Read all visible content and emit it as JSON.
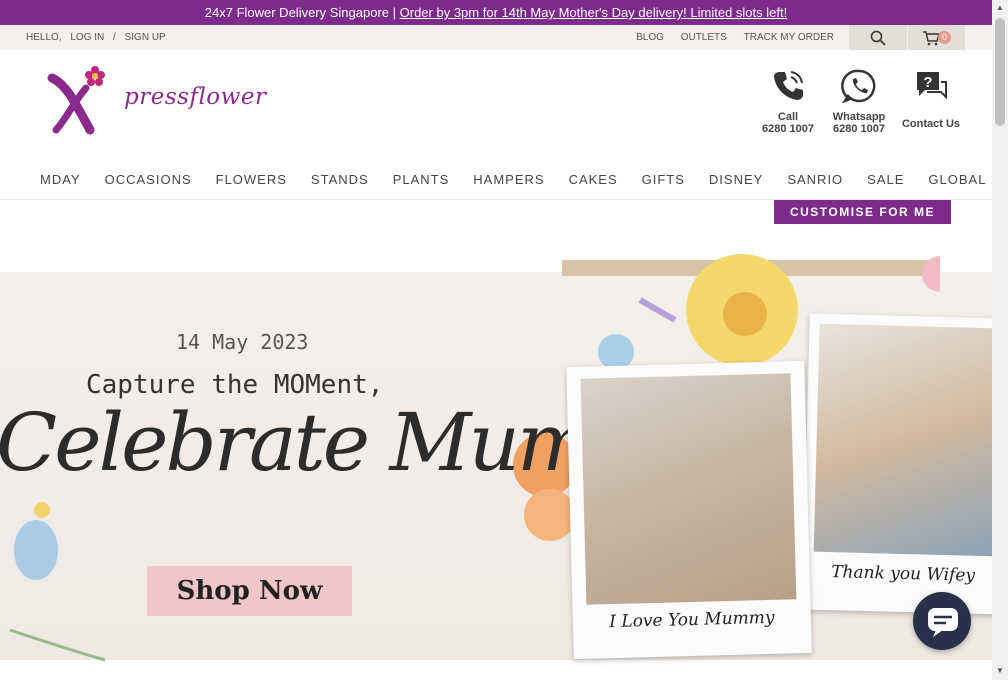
{
  "promo": {
    "text": "24x7 Flower Delivery Singapore |",
    "link": "Order by 3pm for 14th May Mother's Day delivery! Limited slots left!"
  },
  "util": {
    "hello": "HELLO,",
    "login": "LOG IN",
    "sep": "/",
    "signup": "SIGN UP",
    "blog": "BLOG",
    "outlets": "OUTLETS",
    "track": "TRACK MY ORDER",
    "cart_count": "0"
  },
  "brand": {
    "logo_text": "pressflower"
  },
  "contact": {
    "call_label": "Call",
    "call_number": "6280 1007",
    "whatsapp_label": "Whatsapp",
    "whatsapp_number": "6280 1007",
    "contact_label": "Contact Us"
  },
  "nav": [
    "MDAY",
    "OCCASIONS",
    "FLOWERS",
    "STANDS",
    "PLANTS",
    "HAMPERS",
    "CAKES",
    "GIFTS",
    "DISNEY",
    "SANRIO",
    "SALE",
    "GLOBAL"
  ],
  "customise": "CUSTOMISE FOR ME",
  "hero": {
    "date": "14 May 2023",
    "headline": "Capture the MOMent,",
    "script": "Celebrate Mum",
    "cta": "Shop Now",
    "caption1": "I Love You Mummy",
    "caption2": "Thank you Wifey"
  },
  "colors": {
    "brand": "#7d2a8c",
    "cta_bg": "#f1c6c9",
    "chat_bg": "#27324a"
  },
  "icons": [
    "search-icon",
    "cart-icon",
    "phone-icon",
    "whatsapp-icon",
    "help-icon",
    "chat-icon"
  ]
}
